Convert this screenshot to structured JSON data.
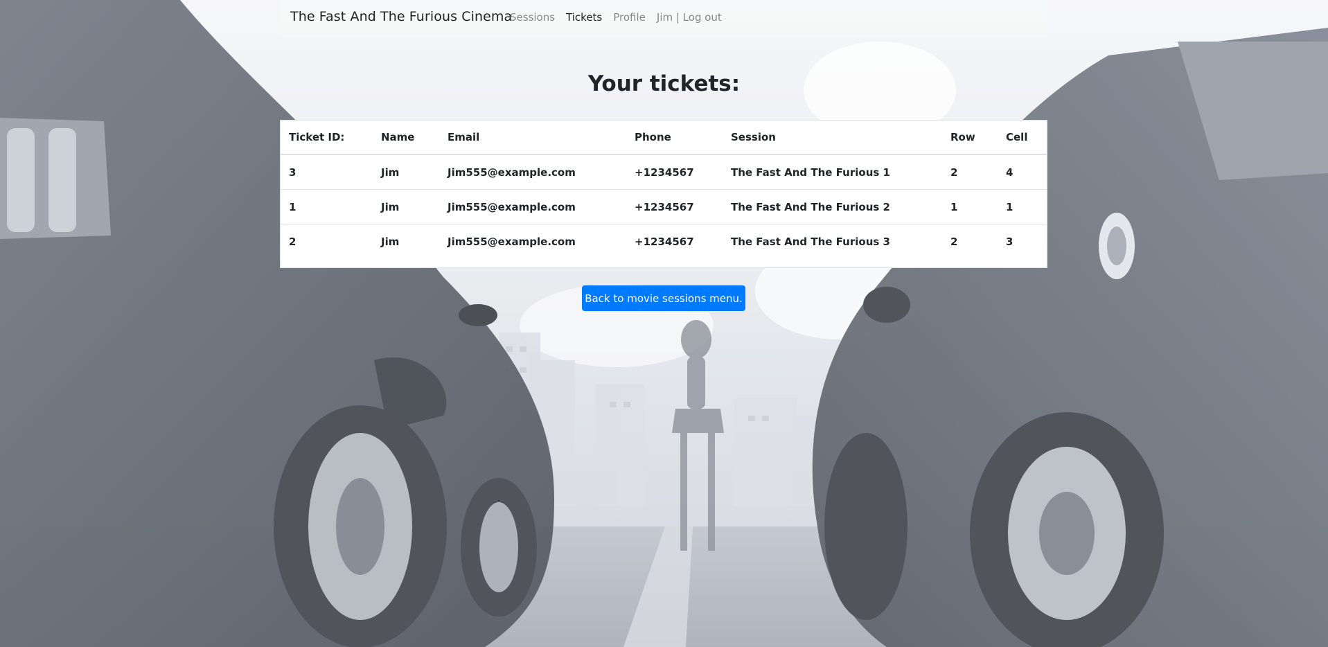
{
  "navbar": {
    "brand": "The Fast And The Furious Cinema",
    "links": [
      {
        "label": "Sessions",
        "active": false
      },
      {
        "label": "Tickets",
        "active": true
      },
      {
        "label": "Profile",
        "active": false
      },
      {
        "label": "Jim | Log out",
        "active": false
      }
    ]
  },
  "page": {
    "title": "Your tickets:"
  },
  "tickets_table": {
    "columns": [
      "Ticket ID:",
      "Name",
      "Email",
      "Phone",
      "Session",
      "Row",
      "Cell"
    ],
    "rows": [
      [
        "3",
        "Jim",
        "Jim555@example.com",
        "+1234567",
        "The Fast And The Furious 1",
        "2",
        "4"
      ],
      [
        "1",
        "Jim",
        "Jim555@example.com",
        "+1234567",
        "The Fast And The Furious 2",
        "1",
        "1"
      ],
      [
        "2",
        "Jim",
        "Jim555@example.com",
        "+1234567",
        "The Fast And The Furious 3",
        "2",
        "3"
      ]
    ]
  },
  "actions": {
    "back_label": "Back to movie sessions menu."
  },
  "colors": {
    "primary": "#007bff",
    "text": "#212529",
    "nav_muted": "#888888"
  }
}
